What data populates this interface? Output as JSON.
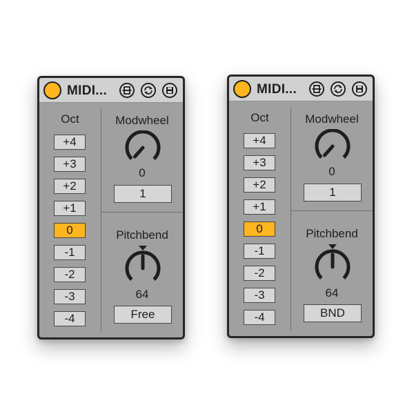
{
  "devices": [
    {
      "title": "MIDI...",
      "octave_label": "Oct",
      "octave_buttons": [
        "+4",
        "+3",
        "+2",
        "+1",
        "0",
        "-1",
        "-2",
        "-3",
        "-4"
      ],
      "octave_selected": "0",
      "modwheel": {
        "label": "Modwheel",
        "value": "0",
        "field": "1"
      },
      "pitchbend": {
        "label": "Pitchbend",
        "value": "64",
        "field": "Free"
      }
    },
    {
      "title": "MIDI...",
      "octave_label": "Oct",
      "octave_buttons": [
        "+4",
        "+3",
        "+2",
        "+1",
        "0",
        "-1",
        "-2",
        "-3",
        "-4"
      ],
      "octave_selected": "0",
      "modwheel": {
        "label": "Modwheel",
        "value": "0",
        "field": "1"
      },
      "pitchbend": {
        "label": "Pitchbend",
        "value": "64",
        "field": "BND"
      }
    }
  ],
  "titlebar_icons": [
    "device-fold-icon",
    "refresh-icon",
    "save-icon"
  ],
  "colors": {
    "accent": "#fdb61f",
    "panel": "#a0a0a0",
    "titlebar": "#d1d1d1",
    "button": "#d6d6d6",
    "ink": "#1e1e1e"
  }
}
